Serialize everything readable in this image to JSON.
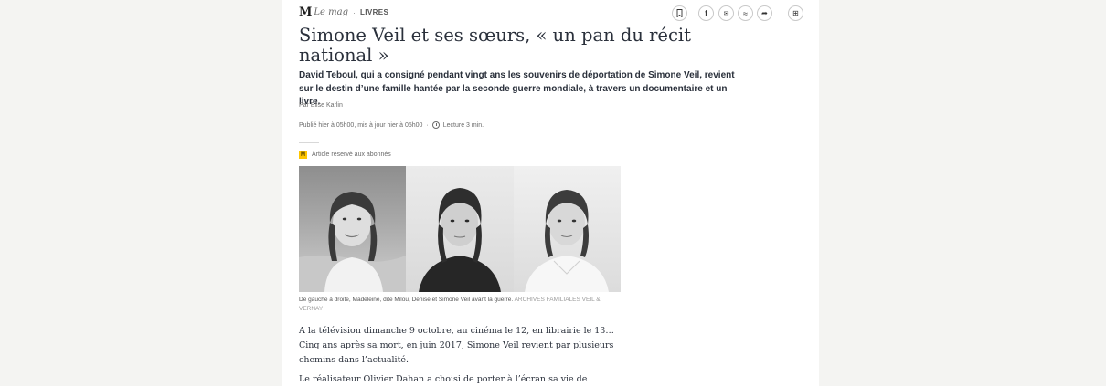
{
  "brand": {
    "logo_m": "M",
    "logo_mag": "Le mag",
    "separator": "·",
    "rubric": "LIVRES"
  },
  "toolbar": {
    "icons": [
      "bookmark-icon",
      "facebook-icon",
      "email-icon",
      "messenger-icon",
      "share-icon",
      "gift-icon"
    ],
    "facebook_glyph": "f",
    "email_glyph": "✉",
    "messenger_glyph": "≈",
    "share_glyph": "➦",
    "gift_glyph": "⊞"
  },
  "article": {
    "title": "Simone Veil et ses sœurs, « un pan du récit national »",
    "dek": "David Teboul, qui a consigné pendant vingt ans les souvenirs de déportation de Simone Veil, revient sur le destin d’une famille hantée par la seconde guerre mondiale, à travers un documentaire et un livre.",
    "byline": "Par Elise Karlin",
    "published": "Publié hier à 05h00, mis à jour hier à 05h00",
    "separator": "·",
    "reading_time": "Lecture 3 min.",
    "subscriber_badge": "M",
    "subscriber_label": "Article réservé aux abonnés",
    "caption": "De gauche à droite, Madeleine, dite Milou, Denise et Simone Veil avant la guerre.",
    "caption_credit": "Archives familiales Veil & Vernay",
    "paragraphs": [
      "A la télévision dimanche 9 octobre, au cinéma le 12, en librairie le 13… Cinq ans après sa mort, en juin 2017, Simone Veil revient par plusieurs chemins dans l’actualité.",
      "Le réalisateur Olivier Dahan a choisi de porter à l’écran sa vie de combats dans"
    ]
  },
  "colors": {
    "text": "#2a303b",
    "muted": "#6b6b6b",
    "subscriber_yellow": "#ffc600",
    "page_bg": "#ffffff",
    "outer_bg": "#f4f4f2"
  }
}
